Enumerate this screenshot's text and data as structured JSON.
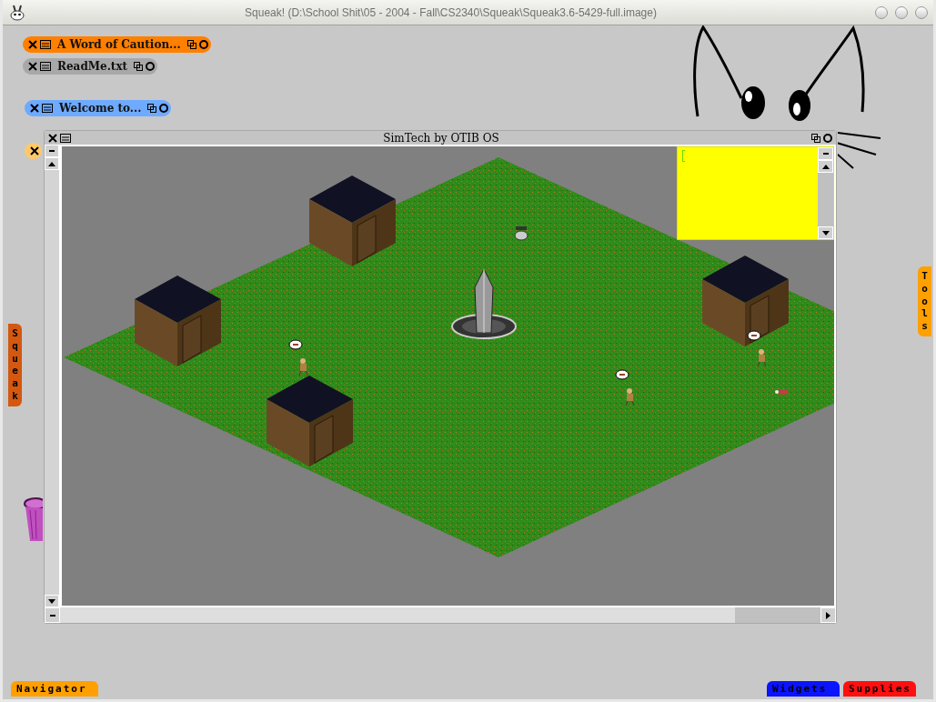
{
  "title_bar": {
    "title": "Squeak! (D:\\School Shit\\05 - 2004 - Fall\\CS2340\\Squeak\\Squeak3.6-5429-full.image)"
  },
  "collapsed_windows": [
    {
      "title": "A Word of Caution...",
      "color": "#ff7f00"
    },
    {
      "title": "ReadMe.txt",
      "color": "#a8a8a8"
    },
    {
      "title": "Welcome to...",
      "color": "#6eaaff"
    },
    {
      "color": "#ffc868"
    }
  ],
  "main_window": {
    "title": "SimTech by OTIB OS"
  },
  "side_flaps": [
    {
      "label": "Squeak",
      "color": "#d45810"
    },
    {
      "label": "Tools",
      "color": "#ffa000"
    }
  ],
  "bottom_flaps": [
    {
      "label": "Navigator",
      "color": "#ffa000"
    },
    {
      "label": "Widgets",
      "color": "#0a14ff"
    },
    {
      "label": "Supplies",
      "color": "#ff1010"
    }
  ]
}
